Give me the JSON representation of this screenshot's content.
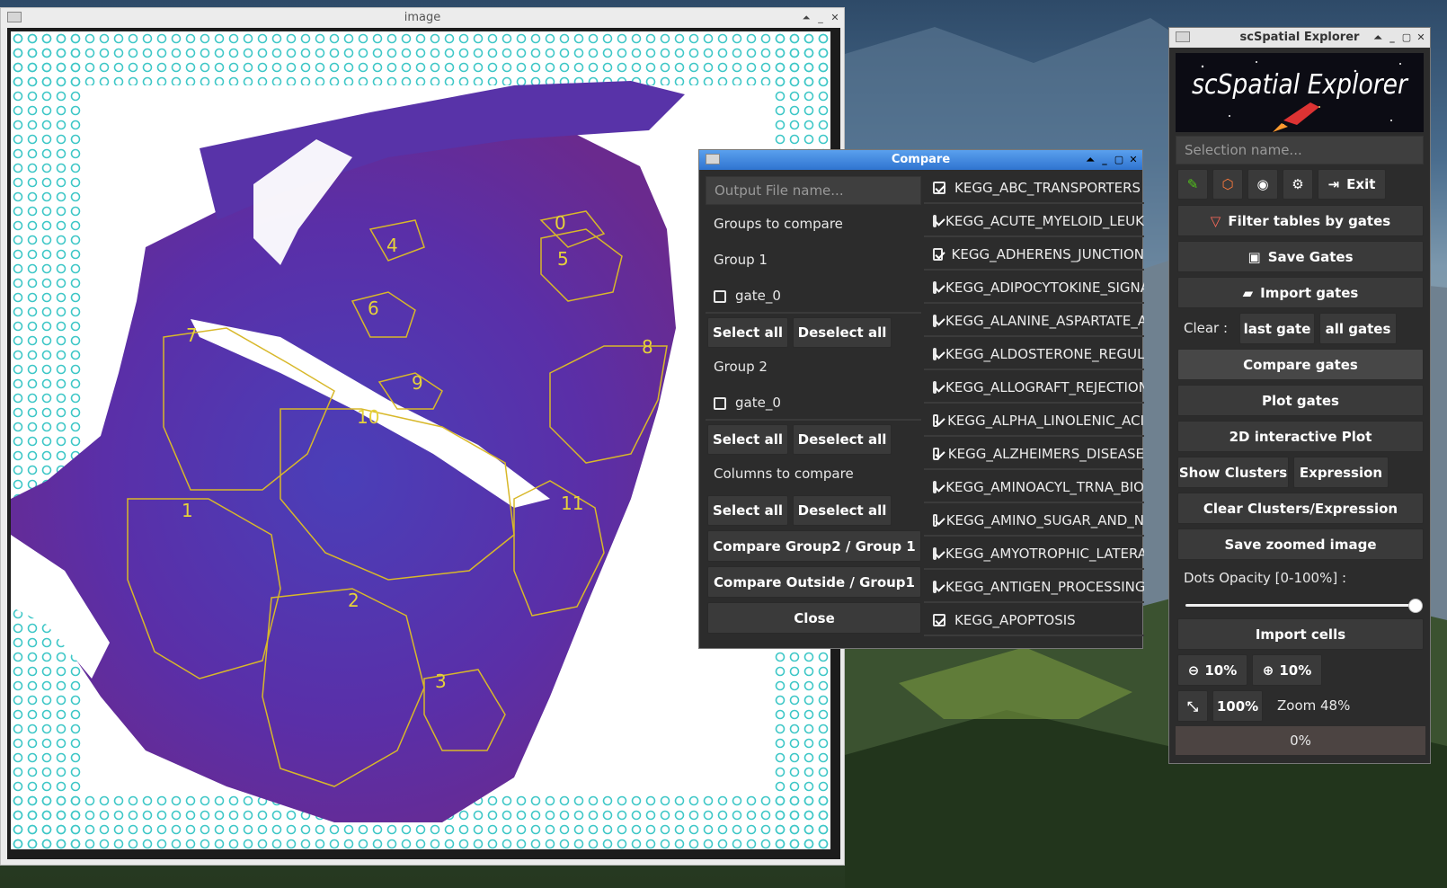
{
  "image_window": {
    "title": "image",
    "gate_labels": [
      "0",
      "1",
      "2",
      "3",
      "4",
      "5",
      "6",
      "7",
      "8",
      "9",
      "10",
      "11"
    ]
  },
  "compare_window": {
    "title": "Compare",
    "output_placeholder": "Output File name...",
    "groups_label": "Groups to compare",
    "group1_label": "Group 1",
    "group1_gate": "gate_0",
    "group2_label": "Group 2",
    "group2_gate": "gate_0",
    "columns_label": "Columns to compare",
    "select_all": "Select all",
    "deselect_all": "Deselect all",
    "compare_g2_g1": "Compare Group2 / Group 1",
    "compare_out_g1": "Compare Outside / Group1",
    "close": "Close",
    "kegg_items": [
      "KEGG_ABC_TRANSPORTERS",
      "KEGG_ACUTE_MYELOID_LEUK",
      "KEGG_ADHERENS_JUNCTION",
      "KEGG_ADIPOCYTOKINE_SIGNA",
      "KEGG_ALANINE_ASPARTATE_A",
      "KEGG_ALDOSTERONE_REGULA",
      "KEGG_ALLOGRAFT_REJECTION",
      "KEGG_ALPHA_LINOLENIC_ACI",
      "KEGG_ALZHEIMERS_DISEASE",
      "KEGG_AMINOACYL_TRNA_BIO",
      "KEGG_AMINO_SUGAR_AND_N",
      "KEGG_AMYOTROPHIC_LATERA",
      "KEGG_ANTIGEN_PROCESSING",
      "KEGG_APOPTOSIS"
    ]
  },
  "explorer_window": {
    "title": "scSpatial Explorer",
    "logo_text": "scSpatial Explorer",
    "selection_placeholder": "Selection name...",
    "exit_label": "Exit",
    "filter_label": "Filter tables by gates",
    "save_gates": "Save Gates",
    "import_gates": "Import gates",
    "clear_label": "Clear :",
    "last_gate": "last gate",
    "all_gates": "all gates",
    "compare_gates": "Compare gates",
    "plot_gates": "Plot gates",
    "interactive_plot": "2D interactive Plot",
    "show_clusters": "Show Clusters",
    "expression": "Expression",
    "clear_clusters": "Clear Clusters/Expression",
    "save_zoomed": "Save zoomed image",
    "dots_opacity_label": "Dots Opacity [0-100%] :",
    "dots_opacity_value": 100,
    "import_cells": "Import cells",
    "zoom_out": "10%",
    "zoom_in": "10%",
    "zoom_100": "100%",
    "zoom_status": "Zoom 48%",
    "progress": "0%",
    "icons": [
      "brush-icon",
      "hexagon-icon",
      "camera-icon",
      "gear-icon",
      "exit-icon",
      "filter-icon",
      "save-icon",
      "folder-icon",
      "zoom-out-icon",
      "zoom-in-icon",
      "fit-icon"
    ],
    "colors": {
      "accent_green": "#52c41a",
      "accent_orange": "#ff7a3c",
      "filter_red": "#ff6b5b"
    }
  }
}
